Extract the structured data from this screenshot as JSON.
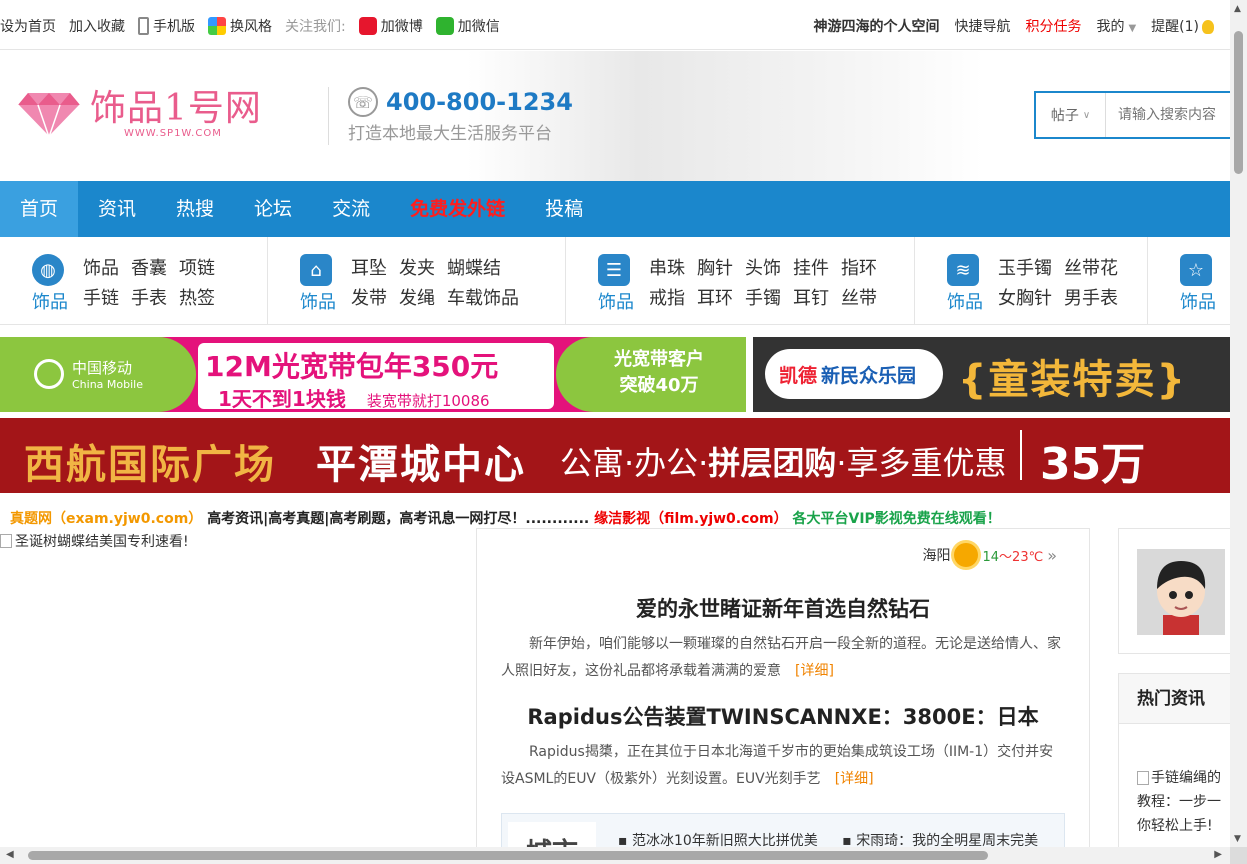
{
  "topbar": {
    "set_home": "设为首页",
    "add_fav": "加入收藏",
    "mobile": "手机版",
    "skin": "换风格",
    "follow": "关注我们:",
    "weibo": "加微博",
    "wechat": "加微信",
    "user_space": "神游四海的个人空间",
    "quick_nav": "快捷导航",
    "points_task": "积分任务",
    "mine": "我的",
    "remind": "提醒(1)"
  },
  "header": {
    "logo_text": "饰品1号网",
    "logo_url": "WWW.SP1W.COM",
    "phone": "400-800-1234",
    "slogan": "打造本地最大生活服务平台"
  },
  "search": {
    "type": "帖子",
    "placeholder": "请输入搜索内容"
  },
  "nav": {
    "items": [
      "首页",
      "资讯",
      "热搜",
      "论坛",
      "交流",
      "免费发外链",
      "投稿"
    ]
  },
  "categories": [
    {
      "label": "饰品",
      "icon": "globe-icon",
      "row1": [
        "饰品",
        "香囊",
        "项链"
      ],
      "row2": [
        "手链",
        "手表",
        "热签"
      ]
    },
    {
      "label": "饰品",
      "icon": "home-icon",
      "row1": [
        "耳坠",
        "发夹",
        "蝴蝶结"
      ],
      "row2": [
        "发带",
        "发绳",
        "车载饰品"
      ]
    },
    {
      "label": "饰品",
      "icon": "list-icon",
      "row1": [
        "串珠",
        "胸针",
        "头饰",
        "挂件",
        "指环"
      ],
      "row2": [
        "戒指",
        "耳环",
        "手镯",
        "耳钉",
        "丝带"
      ]
    },
    {
      "label": "饰品",
      "icon": "layers-icon",
      "row1": [
        "玉手镯",
        "丝带花"
      ],
      "row2": [
        "女胸针",
        "男手表"
      ]
    },
    {
      "label": "饰品",
      "icon": "star-icon",
      "row1": [],
      "row2": []
    }
  ],
  "banners": {
    "b1": {
      "brand": "中国移动",
      "brand_en": "China Mobile",
      "headline": "12M光宽带包年350元",
      "sub": "1天不到1块钱",
      "sub_note": "装宽带就打10086",
      "right_line1": "光宽带客户",
      "right_line2": "突破40万"
    },
    "b2": {
      "brand_a": "凯德",
      "brand_b": "新民众乐园",
      "title": "{童装特卖}"
    },
    "b3": {
      "part1": "西航国际广场",
      "part2": "平潭城中心",
      "part3a": "公寓·办公·",
      "part3b": "拼层团购",
      "part3c": "·享多重优惠",
      "price": "35万"
    }
  },
  "ticker": {
    "site1": "真题网（exam.yjw0.com）",
    "text1": "高考资讯|高考真题|高考刷题，高考讯息一网打尽！............",
    "site2": "缘洁影视（film.yjw0.com）",
    "text2": "各大平台VIP影视免费在线观看！"
  },
  "broken_image_alt": "圣诞树蝴蝶结美国专利速看!",
  "weather": {
    "city": "海阳",
    "low": "14",
    "sep": "～",
    "high": "23℃",
    "more": "»"
  },
  "articles": [
    {
      "title": "爱的永世睹证新年首选自然钻石",
      "summary": "新年伊始，咱们能够以一颗璀璨的自然钻石开启一段全新的道程。无论是送给情人、家人照旧好友，这份礼品都将承载着满满的爱意",
      "more": "[详细]"
    },
    {
      "title": "Rapidus公告装置TWINSCANNXE：3800E：日本",
      "summary": "Rapidus揭橥，正在其位于日本北海道千岁市的更始集成筑设工场（IIM-1）交付并安设ASML的EUV（极紫外）光刻设置。EUV光刻手艺",
      "more": "[详细]"
    }
  ],
  "city_box": {
    "label": "城市",
    "links": [
      "范冰冰10年新旧照大比拼优美",
      "宋雨琦：我的全明星周末完美"
    ]
  },
  "sidebar": {
    "hot_title": "热门资讯",
    "hot_item_alt": "手链编绳的",
    "hot_item_line2": "教程：一步一",
    "hot_item_line3": "你轻松上手!"
  },
  "colors": {
    "nav_blue": "#1b87cc",
    "nav_active": "#3aa0e0",
    "logo_pink": "#e95c8c",
    "phone_blue": "#1e7ac4",
    "alert_red": "#ff1e1e"
  }
}
